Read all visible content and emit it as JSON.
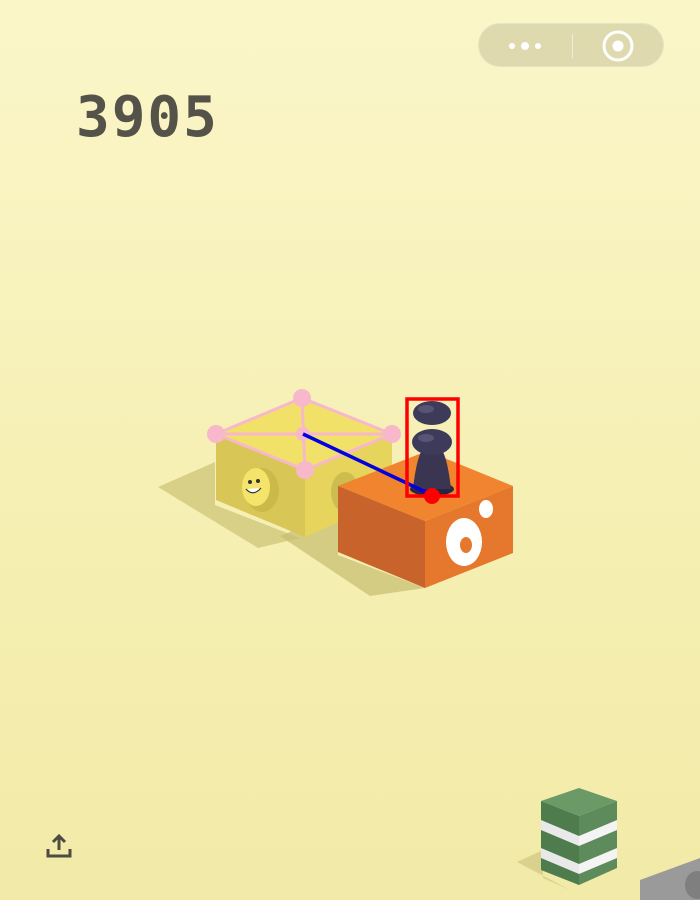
{
  "game": {
    "score": "3905"
  },
  "capsule": {
    "more_icon": "more-dots-icon",
    "close_icon": "target-circle-icon"
  },
  "toolbar": {
    "share_icon": "share-upload-icon"
  },
  "colors": {
    "background": "#f7f1b6",
    "score_text": "#55524a",
    "yellow_block_top": "#f1e169",
    "orange_block_top": "#f0842f",
    "green_block": "#5e8b5b",
    "player_piece": "#3a3550",
    "bbox_outline": "#ff0000",
    "aim_line": "#0000e0",
    "grid_overlay": "#f7b8cc"
  }
}
